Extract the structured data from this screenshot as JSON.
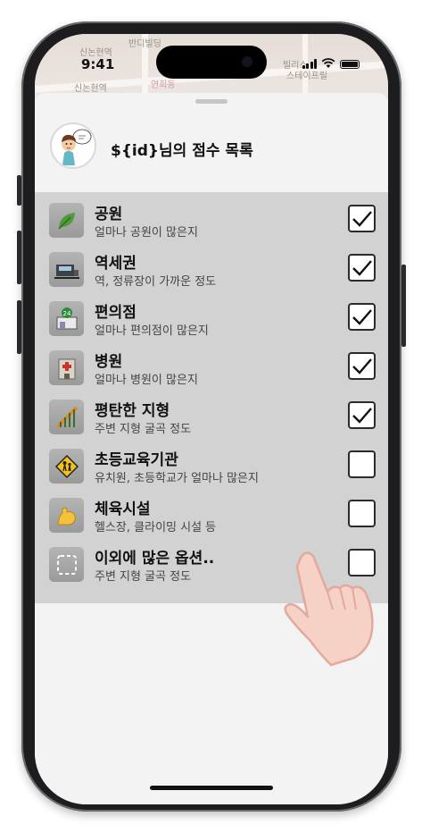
{
  "status_bar": {
    "time": "9:41"
  },
  "map_labels": [
    "신논현역",
    "반디빌딩",
    "빌리스",
    "스테이프릴",
    "신논현역",
    "연희동"
  ],
  "header": {
    "title": "${id}님의 점수 목록"
  },
  "rows": [
    {
      "title": "공원",
      "subtitle": "얼마나 공원이 많은지",
      "checked": true,
      "icon": "leaf-icon"
    },
    {
      "title": "역세권",
      "subtitle": "역, 정류장이 가까운 정도",
      "checked": true,
      "icon": "train-icon"
    },
    {
      "title": "편의점",
      "subtitle": "얼마나 편의점이 많은지",
      "checked": true,
      "icon": "store-24-icon"
    },
    {
      "title": "병원",
      "subtitle": "얼마나 병원이 많은지",
      "checked": true,
      "icon": "hospital-icon"
    },
    {
      "title": "평탄한 지형",
      "subtitle": "주변 지형 굴곡 정도",
      "checked": true,
      "icon": "terrain-chart-icon"
    },
    {
      "title": "초등교육기관",
      "subtitle": "유치원, 초등학교가 얼마나 많은지",
      "checked": false,
      "icon": "school-crossing-icon"
    },
    {
      "title": "체육시설",
      "subtitle": "헬스장, 클라이밍 시설 등",
      "checked": false,
      "icon": "flexed-arm-icon"
    },
    {
      "title": "이외에 많은 옵션..",
      "subtitle": "주변 지형 굴곡 정도",
      "checked": false,
      "icon": "dashed-square-icon"
    }
  ],
  "colors": {
    "sheet": "#f3f3f3",
    "list_band": "#d2d2d2",
    "checkbox_border": "#2b2b2b"
  }
}
